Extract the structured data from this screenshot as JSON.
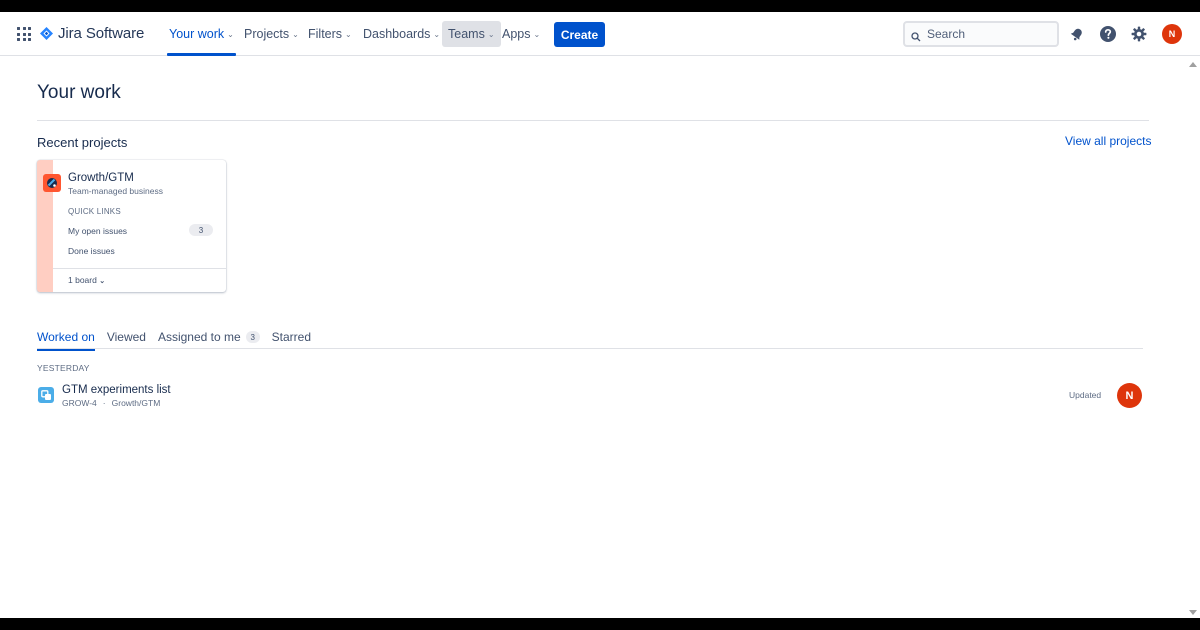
{
  "app": {
    "name": "Jira Software"
  },
  "nav": {
    "items": [
      {
        "label": "Your work"
      },
      {
        "label": "Projects"
      },
      {
        "label": "Filters"
      },
      {
        "label": "Dashboards"
      },
      {
        "label": "Teams"
      },
      {
        "label": "Apps"
      }
    ],
    "create_label": "Create",
    "search_placeholder": "Search",
    "avatar_initial": "N"
  },
  "page": {
    "title": "Your work"
  },
  "recent_projects": {
    "title": "Recent projects",
    "view_all": "View all projects",
    "cards": [
      {
        "name": "Growth/GTM",
        "type": "Team-managed business",
        "quick_links_label": "QUICK LINKS",
        "links": [
          {
            "label": "My open issues",
            "count": "3"
          },
          {
            "label": "Done issues"
          }
        ],
        "board_label": "1 board"
      }
    ]
  },
  "tabs": [
    {
      "label": "Worked on"
    },
    {
      "label": "Viewed"
    },
    {
      "label": "Assigned to me",
      "count": "3"
    },
    {
      "label": "Starred"
    }
  ],
  "activity": {
    "group_label": "YESTERDAY",
    "items": [
      {
        "title": "GTM experiments list",
        "key": "GROW-4",
        "separator": "·",
        "project": "Growth/GTM",
        "status": "Updated",
        "avatar_initial": "N"
      }
    ]
  },
  "colors": {
    "brand": "#0052cc",
    "avatar": "#de350b",
    "project_icon": "#ff5630",
    "issue_icon": "#4bade8"
  },
  "icons": {
    "app_switcher": "grid-icon",
    "logo": "jira-diamond-icon",
    "search": "search-icon",
    "notifications": "bell-icon",
    "help": "help-icon",
    "settings": "gear-icon"
  }
}
